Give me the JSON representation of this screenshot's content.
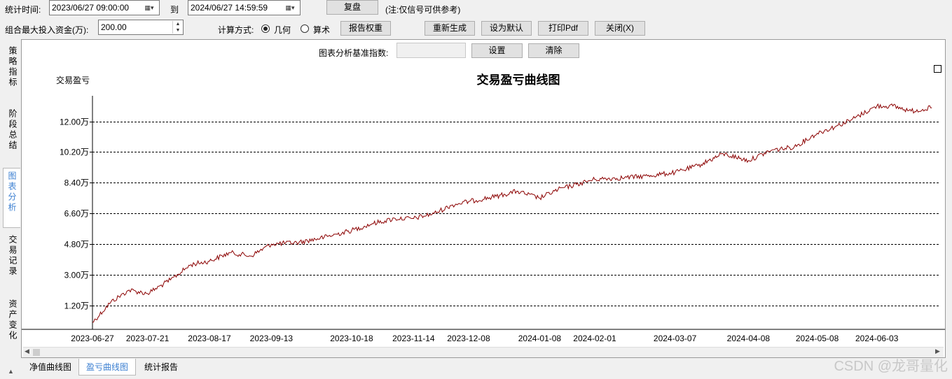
{
  "toolbar": {
    "stat_time_label": "统计时间:",
    "start_time": "2023/06/27 09:00:00",
    "to_label": "到",
    "end_time": "2024/06/27 14:59:59",
    "replay_button": "复盘",
    "note": "(注:仅信号可供参考)",
    "max_capital_label": "组合最大投入资金(万):",
    "max_capital_value": "200.00",
    "calc_method_label": "计算方式:",
    "calc_geometric": "几何",
    "calc_arithmetic": "算术",
    "calc_selected": "几何",
    "report_weight_button": "报告权重",
    "regenerate_button": "重新生成",
    "set_default_button": "设为默认",
    "print_pdf_button": "打印Pdf",
    "close_button": "关闭(X)"
  },
  "sidebar": {
    "items": [
      {
        "label": "策略指标",
        "active": false
      },
      {
        "label": "阶段总结",
        "active": false
      },
      {
        "label": "图表分析",
        "active": true
      },
      {
        "label": "交易记录",
        "active": false
      },
      {
        "label": "资产变化",
        "active": false
      }
    ]
  },
  "chart_panel": {
    "benchmark_label": "图表分析基准指数:",
    "benchmark_value": "",
    "set_button": "设置",
    "clear_button": "清除"
  },
  "bottom_tabs": [
    {
      "label": "净值曲线图",
      "active": false
    },
    {
      "label": "盈亏曲线图",
      "active": true
    },
    {
      "label": "统计报告",
      "active": false
    }
  ],
  "watermark": "CSDN @龙哥量化",
  "colors": {
    "line": "#8b0000",
    "active_tab_text": "#3b7fd1",
    "grid": "#000000"
  },
  "chart_data": {
    "type": "line",
    "title": "交易盈亏曲线图",
    "ylabel": "交易盈亏",
    "xlabel": "",
    "ytick_labels": [
      "1.20万",
      "3.00万",
      "4.80万",
      "6.60万",
      "8.40万",
      "10.20万",
      "12.00万"
    ],
    "yticks": [
      1.2,
      3.0,
      4.8,
      6.6,
      8.4,
      10.2,
      12.0
    ],
    "ylim": [
      -0.2,
      13.5
    ],
    "xtick_labels": [
      "2023-06-27",
      "2023-07-21",
      "2023-08-17",
      "2023-09-13",
      "2023-10-18",
      "2023-11-14",
      "2023-12-08",
      "2024-01-08",
      "2024-02-01",
      "2024-03-07",
      "2024-04-08",
      "2024-05-08",
      "2024-06-03"
    ],
    "grid": "horizontal-dashed",
    "series": [
      {
        "x": [
          "2023-06-27",
          "2023-07-05",
          "2023-07-13",
          "2023-07-21",
          "2023-07-31",
          "2023-08-09",
          "2023-08-17",
          "2023-08-26",
          "2023-09-04",
          "2023-09-13",
          "2023-09-25",
          "2023-10-06",
          "2023-10-18",
          "2023-10-27",
          "2023-11-06",
          "2023-11-14",
          "2023-11-23",
          "2023-12-01",
          "2023-12-08",
          "2023-12-20",
          "2023-12-29",
          "2024-01-08",
          "2024-01-16",
          "2024-01-24",
          "2024-02-01",
          "2024-02-14",
          "2024-02-24",
          "2024-03-07",
          "2024-03-17",
          "2024-03-28",
          "2024-04-08",
          "2024-04-18",
          "2024-04-28",
          "2024-05-08",
          "2024-05-16",
          "2024-05-23",
          "2024-06-03",
          "2024-06-10",
          "2024-06-18",
          "2024-06-27"
        ],
        "y": [
          0.2,
          1.4,
          2.1,
          1.9,
          2.7,
          3.6,
          3.8,
          4.3,
          4.1,
          4.8,
          4.9,
          5.2,
          5.6,
          6.0,
          6.3,
          6.3,
          6.6,
          7.1,
          7.3,
          7.6,
          7.9,
          7.5,
          8.0,
          8.3,
          8.6,
          8.7,
          8.8,
          9.0,
          9.4,
          10.1,
          9.7,
          10.3,
          10.5,
          11.3,
          11.7,
          12.1,
          12.9,
          12.9,
          12.6,
          12.8
        ]
      }
    ]
  }
}
